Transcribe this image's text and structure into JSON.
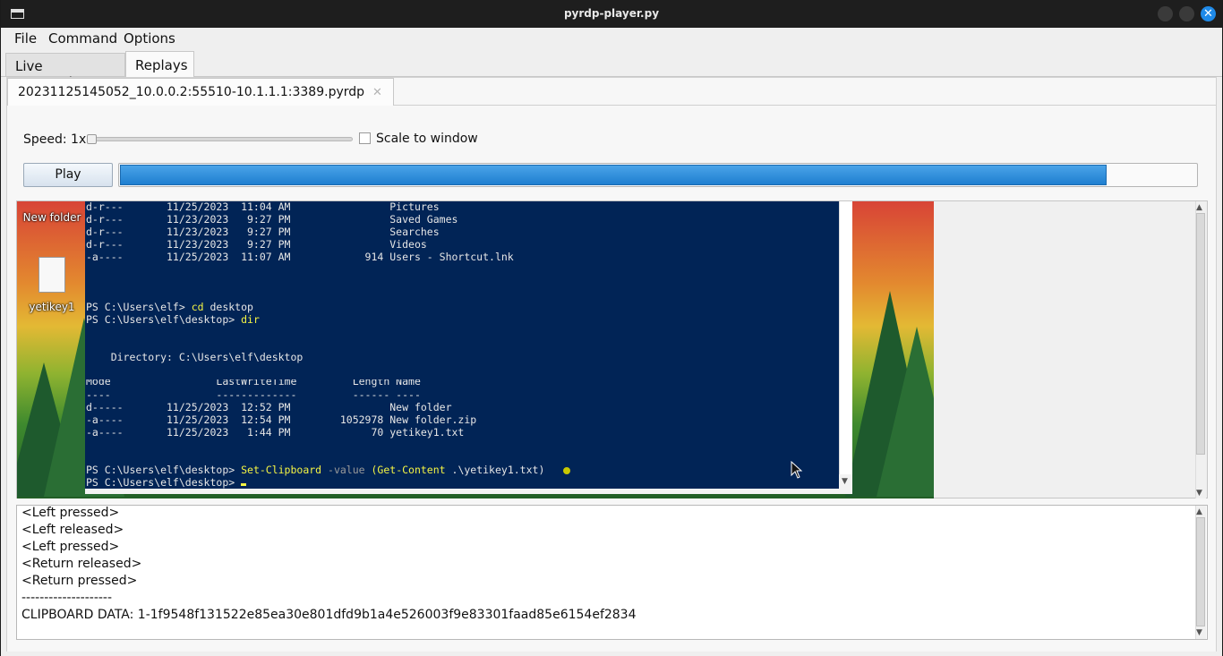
{
  "window": {
    "title": "pyrdp-player.py",
    "close_glyph": "✕"
  },
  "menu": [
    "File",
    "Command",
    "Options"
  ],
  "top_tabs": [
    {
      "label": "Live connections",
      "active": false
    },
    {
      "label": "Replays",
      "active": true
    }
  ],
  "file_tab": {
    "label": "20231125145052_10.0.0.2:55510-10.1.1.1:3389.pyrdp",
    "close_glyph": "✕"
  },
  "controls": {
    "speed_label": "Speed: 1x",
    "speed_value": 1,
    "scale_label": "Scale to window",
    "scale_checked": false,
    "play_label": "Play",
    "progress_fraction": 0.917
  },
  "desktop_icons": [
    {
      "name": "New folder"
    },
    {
      "name": "yetikey1"
    }
  ],
  "terminal_lines": [
    [
      "d-r---       11/25/2023  11:04 AM                Pictures"
    ],
    [
      "d-r---       11/23/2023   9:27 PM                Saved Games"
    ],
    [
      "d-r---       11/23/2023   9:27 PM                Searches"
    ],
    [
      "d-r---       11/23/2023   9:27 PM                Videos"
    ],
    [
      "-a----       11/25/2023  11:07 AM            914 Users - Shortcut.lnk"
    ],
    [
      "PS C:\\Users\\elf> ",
      "cd",
      " desktop"
    ],
    [
      "PS C:\\Users\\elf\\desktop> ",
      "dir"
    ],
    [
      "    Directory: C:\\Users\\elf\\desktop"
    ],
    [
      "Mode                 LastWriteTime         Length Name"
    ],
    [
      "----                 -------------         ------ ----"
    ],
    [
      "d-----       11/25/2023  12:52 PM                New folder"
    ],
    [
      "-a----       11/25/2023  12:54 PM        1052978 New folder.zip"
    ],
    [
      "-a----       11/25/2023   1:44 PM             70 yetikey1.txt"
    ],
    [
      "PS C:\\Users\\elf\\desktop> ",
      "Set-Clipboard",
      " -value ",
      "(Get-Content",
      " .\\yetikey1.txt)"
    ],
    [
      "PS C:\\Users\\elf\\desktop> "
    ]
  ],
  "log_lines": [
    "<Left pressed>",
    "<Left released>",
    "<Left pressed>",
    "<Return released>",
    "<Return pressed>",
    "--------------------",
    "CLIPBOARD DATA: 1-1f9548f131522e85ea30e801dfd9b1a4e526003f9e83301faad85e6154ef2834"
  ],
  "icons": {
    "window": "window-icon",
    "minimize": "minimize-icon",
    "maximize": "maximize-icon",
    "close": "close-icon",
    "arrow_up": "arrow-up-icon",
    "arrow_down": "arrow-down-icon"
  },
  "colors": {
    "progress": "#1f7fd0",
    "terminal_bg": "#012456",
    "terminal_cmd": "#f5f543",
    "close_button": "#1f8ae8"
  }
}
